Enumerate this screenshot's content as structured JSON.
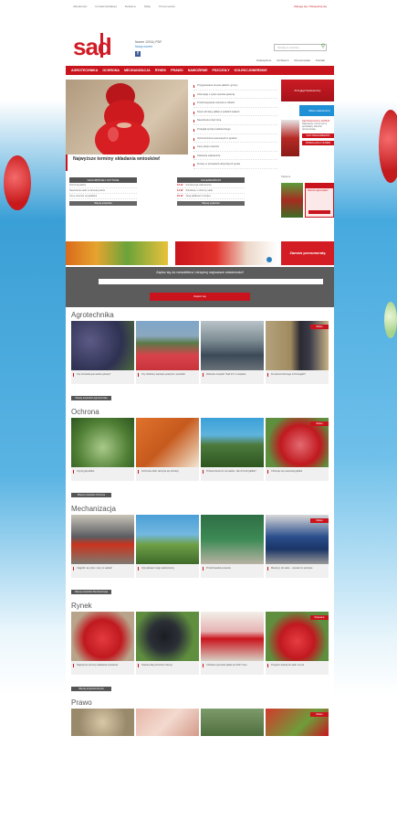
{
  "topbar": {
    "links": [
      "Aktualności",
      "Kontakt Redakcja",
      "Reklama",
      "Sklep",
      "Prenumerata"
    ],
    "right_link": "Zaloguj się / Zarejestruj się"
  },
  "header": {
    "logo": "sad",
    "issue": "Numer 12/16 | PDF",
    "issue_sub": "Nowy numer",
    "fb": "f",
    "search_placeholder": "Szukaj w serwisie",
    "search_icon": "magnifier-icon",
    "links": [
      "Czasopismo",
      "Archiwum",
      "Prenumerata",
      "Kontakt"
    ]
  },
  "nav": [
    "AGROTECHNIKA",
    "OCHRONA",
    "MECHANIZACJA",
    "RYNEK",
    "PRAWO",
    "NAWOŻENIE",
    "PSZCZOŁY",
    "KOLEKCJONERSKIE"
  ],
  "hero": {
    "caption": "Najwyższe terminy składania wniosków!"
  },
  "list": [
    "Przygotowanie zimowe jabłoni i gruszy",
    "Informacje o rynku owoców jesienią",
    "Przechowywanie owoców w chłodni",
    "Nowe odmiany jabłek w polskich sadach",
    "Nawożenie przed zimą",
    "Przegląd sprzętu sadowniczego",
    "Ochrona drzew owocowych w grudniu",
    "Ceny skupu owoców",
    "Szkolenia sadownicze",
    "Zmiany w przepisach dotyczących upraw"
  ],
  "side": {
    "banner1": "Przegląd Sadowniczy",
    "banner2": "Sklep sadowniczy",
    "book_title": "Sad Nowoczesny 12/2016",
    "book_text": "Najnowszy numer już w sprzedaży. Zamów prenumeratę.",
    "book_btn1": "KUP PRENUMERATĘ",
    "book_btn2": "PRZEGLĄDAJ NUMER"
  },
  "widgets": {
    "left_title": "NAJCZĘŚCIEJ CZYTANE",
    "left_rows": [
      "Ochrona jabłoni",
      "Nawożenie sadu w okresie jesieni",
      "Ceny owoców na giełdach"
    ],
    "left_btn": "Więcej artykułów",
    "right_title": "KALENDARIUM",
    "right_rows": [
      {
        "date": "12.12",
        "text": "Konferencja sadownicza"
      },
      {
        "date": "14.12",
        "text": "Szkolenie z ochrony sadu"
      },
      {
        "date": "16.12",
        "text": "Targi jabłkowe w Grójcu"
      }
    ],
    "right_btn": "Więcej wydarzeń",
    "side_label": "Reklama",
    "side_form_title": "Zamów egzemplarz"
  },
  "promo": {
    "right": "Zamów prenumeratę"
  },
  "newsletter": {
    "title": "Zapisz się do newslettera i otrzymuj najnowsze wiadomości!",
    "button": "Zapisz się"
  },
  "sections": [
    {
      "title": "Agrotechnika",
      "cards": [
        {
          "caption": "Czy borówka jest warta uprawy?",
          "tag": ""
        },
        {
          "caption": "Czy dzielnicy sączące pokrycie i poradnik",
          "tag": ""
        },
        {
          "caption": "Zebranie zespołu \"Sad 21\" w Jaspisie",
          "tag": ""
        },
        {
          "caption": "Do ekonomicznego w Portugalii?",
          "tag": "Wideo"
        }
      ],
      "more": "Więcej artykułów Agrotechnika"
    },
    {
      "title": "Ochrona",
      "cards": [
        {
          "caption": "Czysty jak jabłko",
          "tag": ""
        },
        {
          "caption": "Ochrona roślin zaczyna się od bazy",
          "tag": ""
        },
        {
          "caption": "Przeciw deszczu na sadzie. Jak chronić jabłka?",
          "tag": ""
        },
        {
          "caption": "Chroniąc się owocowej jabłek",
          "tag": "Wideo"
        }
      ],
      "more": "Więcej artykułów Ochrona"
    },
    {
      "title": "Mechanizacja",
      "cards": [
        {
          "caption": "Ciągniki na rynku i ceny w sadach",
          "tag": ""
        },
        {
          "caption": "Opryskiwacz wagi sadowniczej",
          "tag": ""
        },
        {
          "caption": "Przechowalnia owoców",
          "tag": ""
        },
        {
          "caption": "Maszyny do sadu – nowości w sprzęcie",
          "tag": "Wideo"
        }
      ],
      "more": "Więcej artykułów Mechanizacja"
    },
    {
      "title": "Rynek",
      "cards": [
        {
          "caption": "Najwyższe terminy składania wniosków",
          "tag": ""
        },
        {
          "caption": "Szansa dla porzeczki czarnej",
          "tag": ""
        },
        {
          "caption": "Chińskie upominki jabłek do 2017 roku",
          "tag": ""
        },
        {
          "caption": "Program dotacji do sadu na rok",
          "tag": "Polecane"
        }
      ],
      "more": "Więcej artykułów Rynek"
    },
    {
      "title": "Prawo",
      "cards": [
        {
          "caption": "",
          "tag": ""
        },
        {
          "caption": "",
          "tag": ""
        },
        {
          "caption": "",
          "tag": ""
        },
        {
          "caption": "",
          "tag": "Wideo"
        }
      ],
      "more": ""
    }
  ],
  "colors": {
    "brand_red": "#c9141d",
    "bg_blue": "#3aa0d8"
  }
}
